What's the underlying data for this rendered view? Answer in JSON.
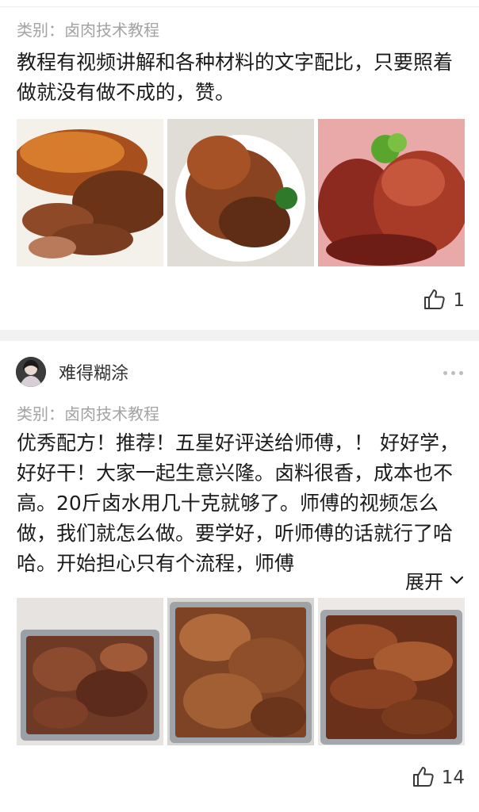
{
  "posts": [
    {
      "category": "类别：卤肉技术教程",
      "text": "教程有视频讲解和各种材料的文字配比，只要照着做就没有做不成的，赞。",
      "images": [
        "pork-knuckle-sliced-photo",
        "pork-knuckle-plate-photo",
        "braised-pork-trotters-photo"
      ],
      "likes": "1",
      "like_icon": "thumbs-up-icon"
    },
    {
      "author": {
        "name": "难得糊涂",
        "avatar": "avatar-photo"
      },
      "category": "类别：卤肉技术教程",
      "text": "优秀配方！推荐！五星好评送给师傅，！ 好好学，好好干！大家一起生意兴隆。卤料很香，成本也不高。20斤卤水用几十克就够了。师傅的视频怎么做，我们就怎么做。要学好，听师傅的话就行了哈哈。开始担心只有个流程，师傅",
      "expand_label": "展开",
      "images": [
        "braised-meat-tray-photo",
        "braised-pork-tray-photo",
        "braised-ribs-tray-photo"
      ],
      "likes": "14",
      "like_icon": "thumbs-up-icon"
    }
  ]
}
